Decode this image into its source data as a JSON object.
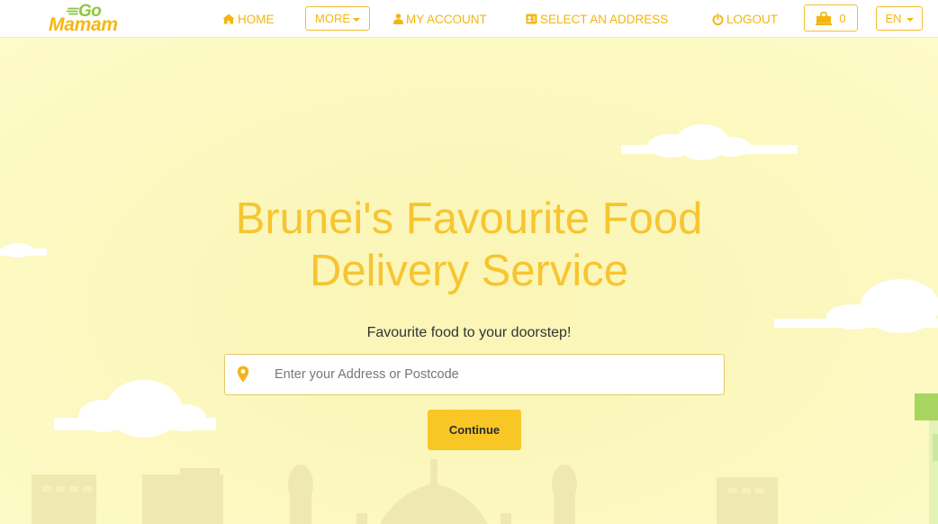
{
  "brand": {
    "logo_top": "Go",
    "logo_bottom": "Mamam"
  },
  "nav": {
    "home": "HOME",
    "more": "MORE",
    "my_account": "MY ACCOUNT",
    "select_address": "SELECT AN ADDRESS",
    "logout": "LOGOUT",
    "cart_count": "0",
    "language": "EN"
  },
  "hero": {
    "headline_line1": "Brunei's Favourite Food",
    "headline_line2": "Delivery Service",
    "tagline": "Favourite food to your doorstep!",
    "address_placeholder": "Enter your Address or Postcode",
    "address_value": "",
    "continue_label": "Continue"
  },
  "icons": {
    "home": "home-icon",
    "account": "user-icon",
    "address": "address-card-icon",
    "logout": "power-icon",
    "cart": "shopping-bag-icon",
    "location": "map-pin-icon"
  },
  "colors": {
    "brand_yellow": "#f5b50f",
    "brand_green": "#8dc63f",
    "headline": "#f7c531",
    "button": "#f8c726",
    "hero_bg": "#fcfac0"
  }
}
